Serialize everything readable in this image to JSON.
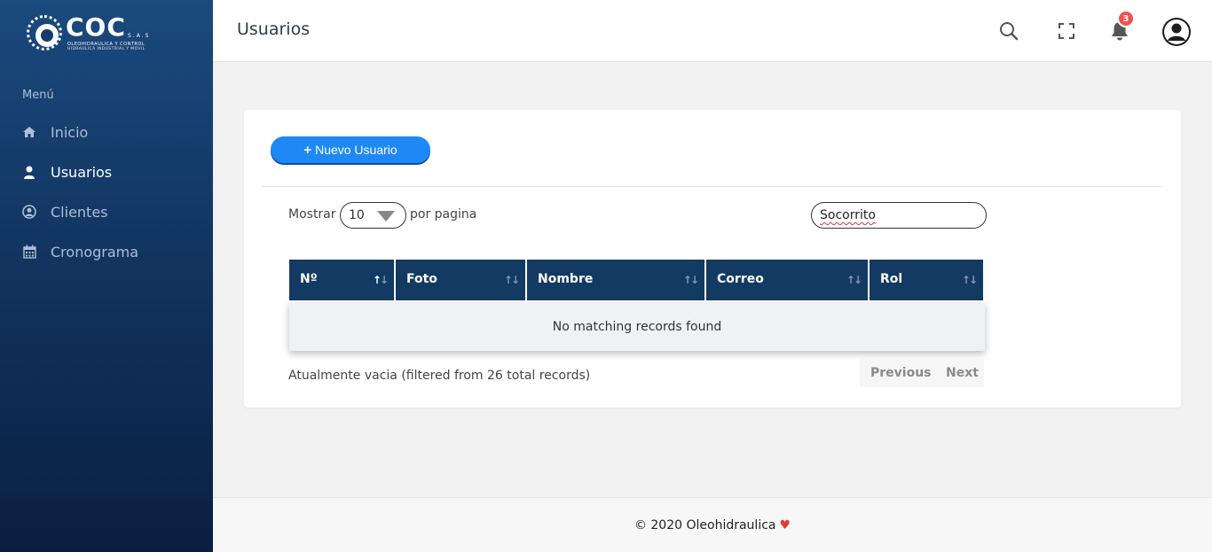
{
  "brand": {
    "name": "COC",
    "suffix": "S.A.S",
    "tagline1": "OLEOHIDRAULICA Y CONTROL",
    "tagline2": "HIDRAULICA INDUSTRIAL Y MOVIL"
  },
  "sidebar": {
    "menu_title": "Menú",
    "items": [
      {
        "label": "Inicio",
        "icon": "home-icon"
      },
      {
        "label": "Usuarios",
        "icon": "user-icon",
        "active": true
      },
      {
        "label": "Clientes",
        "icon": "user-circle-icon"
      },
      {
        "label": "Cronograma",
        "icon": "calendar-icon"
      }
    ]
  },
  "header": {
    "title": "Usuarios",
    "notification_count": "3",
    "icons": [
      "search-icon",
      "fullscreen-icon",
      "bell-icon",
      "avatar"
    ]
  },
  "content": {
    "new_button": "Nuevo Usuario",
    "show_prefix": "Mostrar",
    "page_size": "10",
    "show_suffix": "por pagina",
    "search_value": "Socorrito",
    "columns": [
      "Nº",
      "Foto",
      "Nombre",
      "Correo",
      "Rol"
    ],
    "empty_message": "No matching records found",
    "info": "Atualmente vacia (filtered from 26 total records)",
    "pagination": {
      "previous": "Previous",
      "next": "Next"
    }
  },
  "footer": {
    "text": "© 2020 Oleohidraulica"
  },
  "colors": {
    "sidebar": "#123561",
    "accent_button": "#1e88f5",
    "table_header": "#123a63",
    "badge": "#f1524c"
  }
}
